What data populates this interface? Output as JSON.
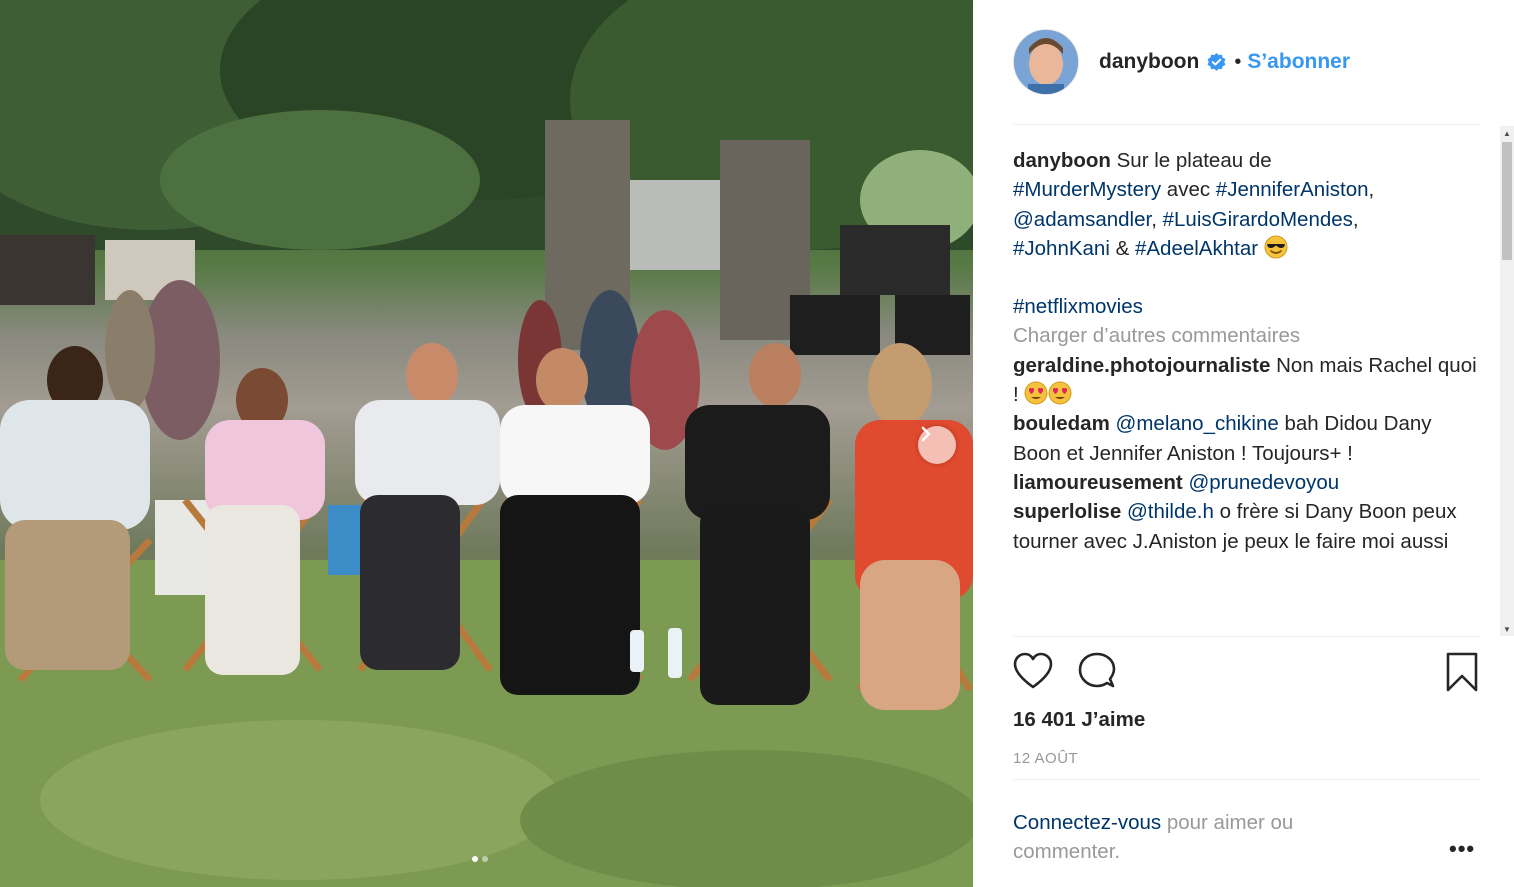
{
  "post": {
    "image_alt": "",
    "carousel_dots": 2,
    "active_dot": 0
  },
  "header": {
    "username": "danyboon",
    "bullet": "•",
    "follow_label": "S’abonner"
  },
  "caption": {
    "username": "danyboon",
    "text_1": " Sur le plateau de ",
    "tag_1": "#MurderMystery",
    "text_2": " avec ",
    "tag_2": "#JenniferAniston",
    "text_3": ", ",
    "tag_3": "@adamsandler",
    "text_4": ", ",
    "tag_4": "#LuisGirardoMendes",
    "text_5": ", ",
    "tag_5": "#JohnKani",
    "text_6": " & ",
    "tag_6": "#AdeelAkhtar",
    "tag_7": "#netflixmovies"
  },
  "load_more_label": "Charger d’autres commentaires",
  "comments": [
    {
      "user": "geraldine.photojournaliste",
      "text": " Non mais Rachel quoi ! ",
      "mention": ""
    },
    {
      "user": "bouledam",
      "mention": "@melano_chikine",
      "text": " bah Didou Dany Boon et Jennifer Aniston ! Toujours+ !"
    },
    {
      "user": "liamoureusement",
      "mention": "@prunedevoyou",
      "text": ""
    },
    {
      "user": "superlolise",
      "mention": "@thilde.h",
      "text": " o frère si Dany Boon peux tourner avec J.Aniston je peux le faire moi aussi"
    }
  ],
  "likes_label": "16 401 J’aime",
  "date_label": "12 AOÛT",
  "login_prompt": {
    "link": "Connectez-vous",
    "rest": " pour aimer ou commenter."
  },
  "options_label": "•••",
  "icons": {
    "like": "heart-icon",
    "comment": "comment-bubble-icon",
    "save": "bookmark-icon",
    "verified": "verified-badge-icon",
    "next": "chevron-right-icon"
  },
  "colors": {
    "link_blue": "#3897f0",
    "hashtag": "#003569",
    "muted": "#999999",
    "text": "#262626"
  }
}
